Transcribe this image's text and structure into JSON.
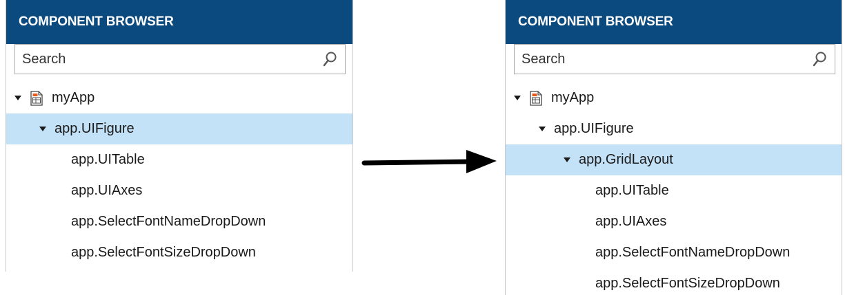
{
  "colors": {
    "header_bg": "#0b4a7e",
    "header_text": "#ffffff",
    "selected_row_bg": "#c4e2f7",
    "arrow": "#000000"
  },
  "left_panel": {
    "header": "COMPONENT BROWSER",
    "search_placeholder": "Search",
    "tree": [
      {
        "label": "myApp",
        "level": 0,
        "expanded": true,
        "icon": "app-file-icon",
        "selected": false
      },
      {
        "label": "app.UIFigure",
        "level": 1,
        "expanded": true,
        "selected": true
      },
      {
        "label": "app.UITable",
        "level": 2,
        "selected": false
      },
      {
        "label": "app.UIAxes",
        "level": 2,
        "selected": false
      },
      {
        "label": "app.SelectFontNameDropDown",
        "level": 2,
        "selected": false
      },
      {
        "label": "app.SelectFontSizeDropDown",
        "level": 2,
        "selected": false
      }
    ]
  },
  "arrow": {
    "icon": "right-arrow-icon"
  },
  "right_panel": {
    "header": "COMPONENT BROWSER",
    "search_placeholder": "Search",
    "tree": [
      {
        "label": "myApp",
        "level": 0,
        "expanded": true,
        "icon": "app-file-icon",
        "selected": false
      },
      {
        "label": "app.UIFigure",
        "level": 1,
        "expanded": true,
        "selected": false
      },
      {
        "label": "app.GridLayout",
        "level": 2,
        "expanded": true,
        "selected": true
      },
      {
        "label": "app.UITable",
        "level": 3,
        "selected": false
      },
      {
        "label": "app.UIAxes",
        "level": 3,
        "selected": false
      },
      {
        "label": "app.SelectFontNameDropDown",
        "level": 3,
        "selected": false
      },
      {
        "label": "app.SelectFontSizeDropDown",
        "level": 3,
        "selected": false
      }
    ]
  }
}
